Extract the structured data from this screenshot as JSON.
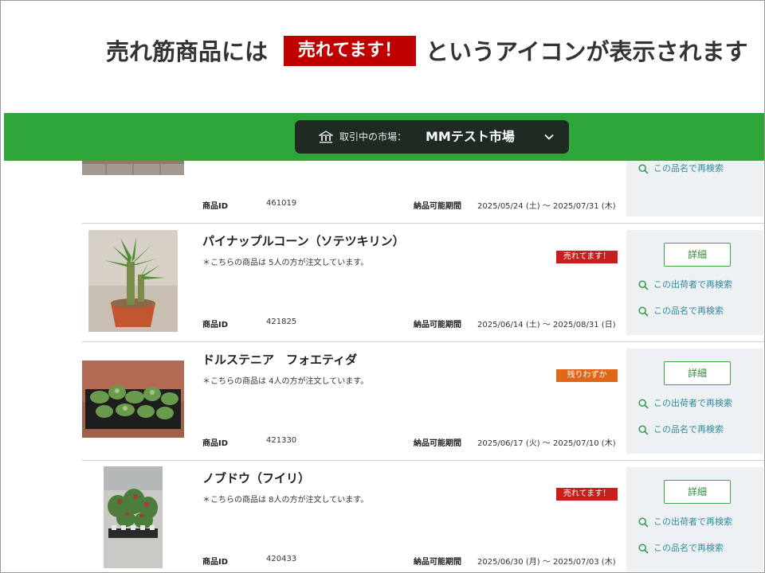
{
  "caption": {
    "before": "売れ筋商品には",
    "badge": "売れてます！",
    "after": "というアイコンが表示されます"
  },
  "market": {
    "label": "取引中の市場：",
    "name": "MMテスト市場",
    "icon": "market-building-icon"
  },
  "buttons": {
    "detail": "詳細",
    "search_shipper": "この出荷者で再検索",
    "search_item": "この品名で再検索"
  },
  "fields": {
    "id_label": "商品ID",
    "period_label": "納品可能期間"
  },
  "products": [
    {
      "title": "",
      "note": "",
      "id": "461019",
      "period": "2025/05/24 (土) ～ 2025/07/31 (木)",
      "tag": ""
    },
    {
      "title": "パイナップルコーン（ソテツキリン）",
      "note": "＊こちらの商品は 5人の方が注文しています。",
      "id": "421825",
      "period": "2025/06/14 (土) ～ 2025/08/31 (日)",
      "tag": "売れてます！"
    },
    {
      "title": "ドルステニア　フォエティダ",
      "note": "＊こちらの商品は 4人の方が注文しています。",
      "id": "421330",
      "period": "2025/06/17 (火) ～ 2025/07/10 (木)",
      "tag": "残りわずか"
    },
    {
      "title": "ノブドウ（フイリ）",
      "note": "＊こちらの商品は 8人の方が注文しています。",
      "id": "420433",
      "period": "2025/06/30 (月) ～ 2025/07/03 (木)",
      "tag": "売れてます！"
    }
  ],
  "colors": {
    "green_bar": "#2ea63a",
    "sold_tag": "#c81e1e",
    "low_stock_tag": "#e0661a",
    "caption_badge": "#c00000"
  }
}
